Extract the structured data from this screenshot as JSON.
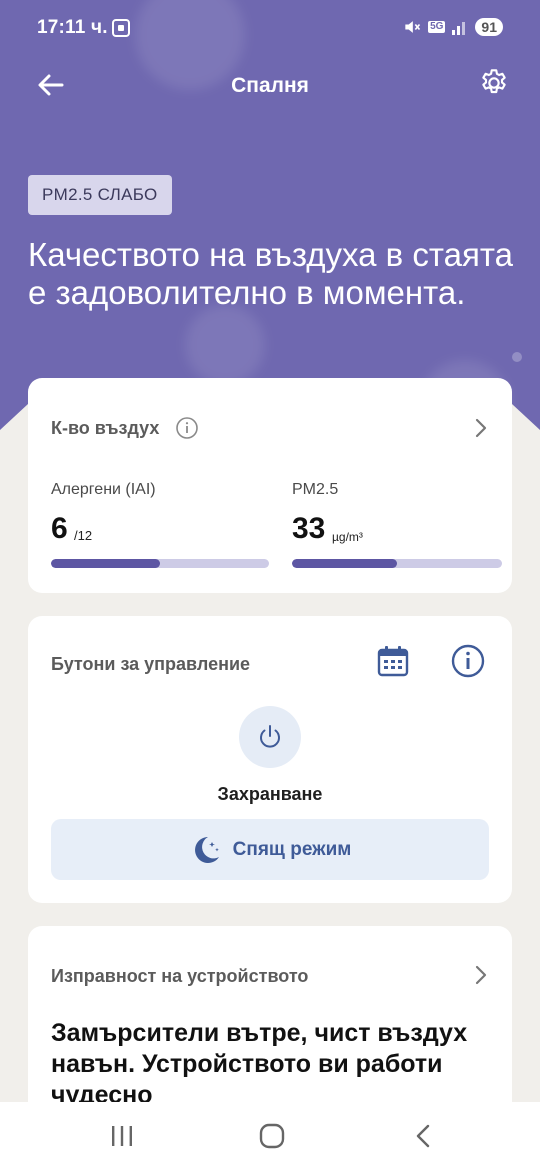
{
  "status": {
    "time": "17:11 ч.",
    "network": "5G",
    "battery": "91"
  },
  "header": {
    "title": "Спалня"
  },
  "air": {
    "chip": "PM2.5 СЛАБО",
    "headline": "Качеството на въздуха в стаята е задоволително в момента."
  },
  "quality_card": {
    "title": "К-во въздух",
    "allergens": {
      "label": "Алергени (IAI)",
      "value": "6",
      "unit": "/12",
      "fraction": 0.5
    },
    "pm25": {
      "label": "PM2.5",
      "value": "33",
      "unit": "µg/m³",
      "fraction": 0.5
    }
  },
  "controls_card": {
    "title": "Бутони за управление",
    "power_label": "Захранване",
    "sleep_label": "Спящ режим"
  },
  "health_card": {
    "title": "Изправност на устройството",
    "text": "Замърсители вътре, чист въздух навън. Устройството ви работи чудесно"
  },
  "colors": {
    "hero": "#6f68b0",
    "accent": "#5d56a3",
    "link": "#3f5b98"
  }
}
